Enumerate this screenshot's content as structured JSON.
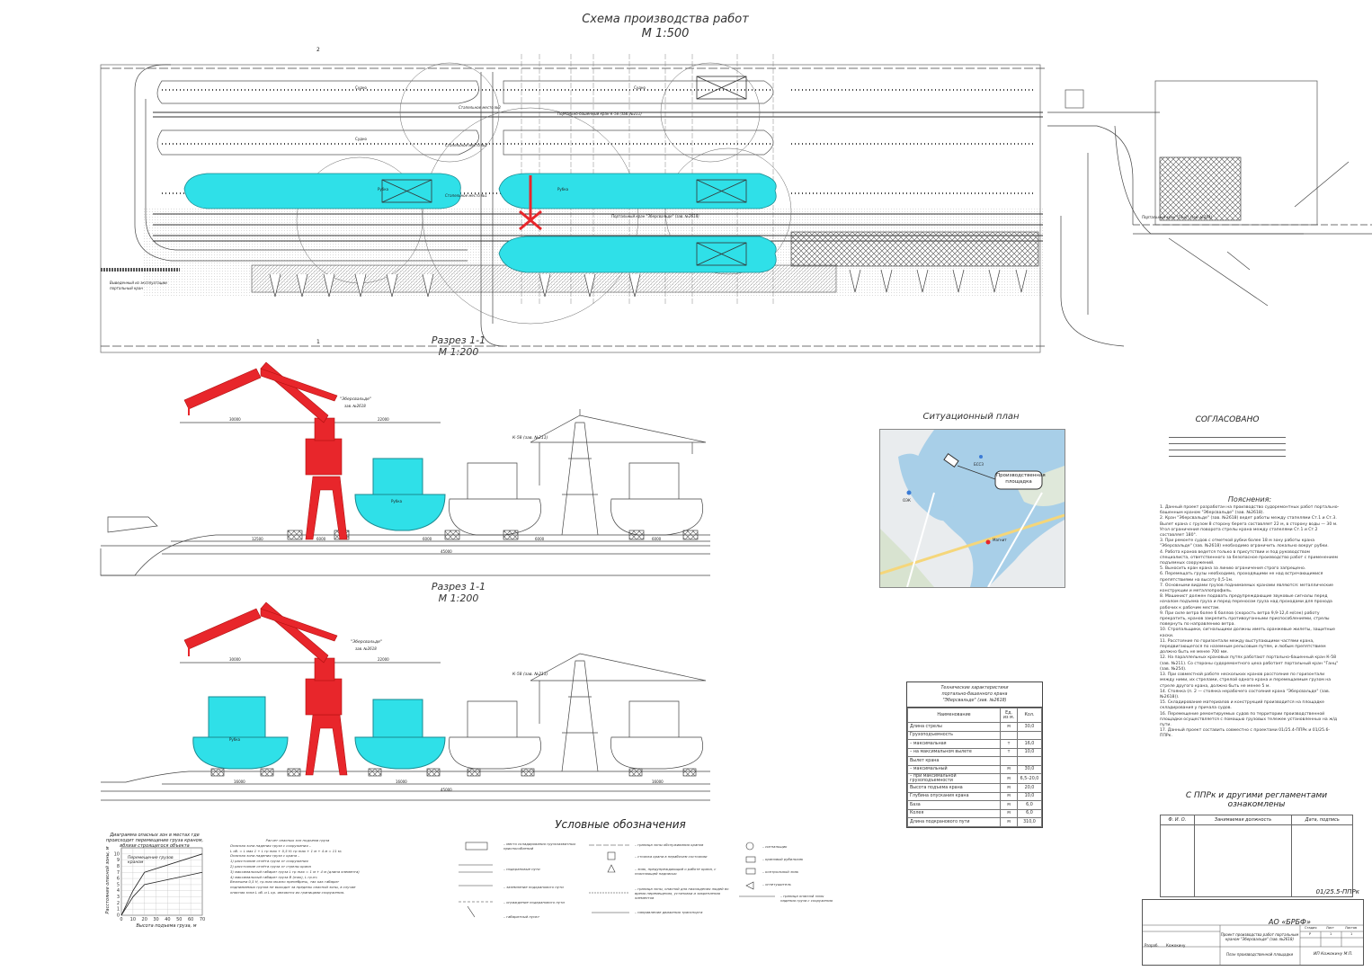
{
  "titles": {
    "main_title": "Схема производства работ",
    "main_scale": "М 1:500",
    "section1_title": "Разрез 1-1",
    "section1_scale": "М 1:200",
    "section2_title": "Разрез 1-1",
    "section2_scale": "М 1:200",
    "situation_title": "Ситуационный план"
  },
  "plan": {
    "berth_labels": [
      "Стапельное место №3",
      "Стапельное место №2",
      "Стапельное место №1"
    ],
    "hull_labels": [
      "Судно",
      "Судно",
      "Судно",
      "Рубка",
      "Рубка"
    ],
    "crane_rail_label_1": "Портально-башенный кран К-58 (зав. №211)",
    "crane_rail_label_2": "Портальный кран \"Зберсвальде\" (зав. №2618)",
    "crane_rail_label_3": "Портальный кран \"Ганц\" (зав. №254)",
    "out_of_service": "Выведенный из эксплуатации портальный кран",
    "marker_2": "2",
    "marker_1": "1"
  },
  "section1": {
    "crane_label": "\"Эберсвальде\"",
    "crane_label_2": "зав. №2618",
    "k58_label": "К-58 (зав. №211)",
    "hull_label": "Рубка",
    "dims": [
      "30000",
      "22000",
      "12500",
      "6000",
      "6000",
      "6000",
      "6000",
      "45000"
    ]
  },
  "section2": {
    "crane_label": "\"Эберсвальде\"",
    "crane_label_2": "зав. №2618",
    "k58_label": "К-58 (зав. №211)",
    "hull_label": "Рубка",
    "dims": [
      "30000",
      "22000",
      "16000",
      "16000",
      "16000",
      "45000"
    ]
  },
  "situation_map": {
    "callout": "Производственная площадка",
    "labels": [
      "БССЗ",
      "ОЭК",
      "Магнит"
    ]
  },
  "approved": {
    "title": "СОГЛАСОВАНО"
  },
  "notes": {
    "title": "Пояснения:",
    "items": [
      "1. Данный проект разработан на производство судоремонтных работ портально-башенным краном \"Эберсвальде\" (зав. №2618).",
      "2. Кран \"Эберсвальде\" (зав. №2618) ведет работы между стапелями Ст.1 и Ст.3. Вылет крана с грузом 8 сторону берега составляет 22 м, в сторону воды — 30 м. Угол ограничения поворота стрелы крана между стапелями Ст.1 и Ст.2 составляет 180°.",
      "3. При ремонте судов с отметкой рубки более 18 м зону работы крана \"Эберсвальде\" (зав. №2618) необходимо ограничить локально вокруг рубки.",
      "4. Работа кранов ведется только в присутствии и под руководством специалиста, ответственного за безопасное производство работ с применением подъемных сооружений.",
      "5. Выносить кран крана за линию ограничения строго запрещено.",
      "6. Перемещать грузы необходимо, проходящими не над встречающимися препятствиями на высоту 0,5-1м.",
      "7. Основными видами грузов поднимаемых кранами являются: металлические конструкции и металлопрофиль.",
      "8. Машинист должен подавать предупреждающие звуковые сигналы перед началом подъема груза и перед переносом груза над проходами для прохода рабочих к рабочим местам.",
      "9. При силе ветра более 6 баллов (скорость ветра 9,9-12,4 м/сек) работу прекратить, кранов закрепить противоугонными приспособлениями, стрелы повернуть по направлению ветра.",
      "10. Стропальщики, сигнальщики должны иметь оранжевые жилеты, защитные каски.",
      "11. Расстояние по горизонтали между выступающими частями крана, передвигающегося по наземным рельсовым путям, и любым препятствием должно быть не менее 700 мм.",
      "12. На параллельных крановых путях работают портально-башенный кран К-58 (зав. №211). Со стороны судоремонтного цеха работает портальный кран \"Ганц\" (зав. №254).",
      "13. При совместной работе нескольких кранов расстояние по горизонтали между ними, их стрелами, стрелой одного крана и перемещаемым грузом на стреле другого крана, должно быть не менее 5 м.",
      "14. Стоянка (п. 2 — стоянка нерабочего состояния крана \"Эберсвальде\" (зав. №2618)).",
      "15. Складирование материалов и конструкций производится на площадке складирования у причала судов.",
      "16. Перемещение ремонтируемых судов по территории производственной площадки осуществляется с помощью грузовых тележек установленных на ж/д пути.",
      "17. Данный проект составить совместно с проектами 01/25.4-ППРк и 01/25.6-ППРк."
    ]
  },
  "spec": {
    "title_line1": "Технические характеристики",
    "title_line2": "портально-башенного крана",
    "title_line3": "\"Эберсвальде\" (зав. №2618)",
    "col_name": "Наименование",
    "col_unit": "Ед. из м.",
    "col_val": "Кол.",
    "rows": [
      {
        "name": "Длина стрелы",
        "unit": "м",
        "val": "30,0"
      },
      {
        "name": "Грузоподъемность",
        "unit": "",
        "val": ""
      },
      {
        "name": "– максимальная",
        "unit": "т",
        "val": "16,0"
      },
      {
        "name": "– на максимальном вылете",
        "unit": "т",
        "val": "10,0"
      },
      {
        "name": "Вылет крана",
        "unit": "",
        "val": ""
      },
      {
        "name": "– максимальный",
        "unit": "м",
        "val": "30,0"
      },
      {
        "name": "– при максимальной грузоподъемности",
        "unit": "м",
        "val": "6,5–20,0"
      },
      {
        "name": "Высота подъема крана",
        "unit": "м",
        "val": "20,0"
      },
      {
        "name": "Глубина опускания крана",
        "unit": "м",
        "val": "10,0"
      },
      {
        "name": "База",
        "unit": "м",
        "val": "6,0"
      },
      {
        "name": "Колея",
        "unit": "м",
        "val": "6,0"
      },
      {
        "name": "Длина подкранового пути",
        "unit": "м",
        "val": "310,0"
      }
    ]
  },
  "familiarization": {
    "title": "С ППРк и другими регламентами ознакомлены",
    "cols": [
      "Ф. И. О.",
      "Занимаемая должность",
      "Дата, подпись"
    ]
  },
  "stamp": {
    "code": "01/25.5-ППРк",
    "org": "АО «БРБФ»",
    "project": "Проект производства работ портальным краном \"Эберсвальде\" (зав. №2618)",
    "sheet_title": "План производственной площадки",
    "firm": "ИП Кожокину М.П.",
    "developed": "Разраб.",
    "developer": "Кожокину",
    "stage": "Стадия",
    "sheet": "Лист",
    "sheets": "Листов",
    "stage_val": "Р",
    "sheet_val": "1",
    "sheets_val": "1"
  },
  "danger_chart": {
    "caption": "Диаграмма опасных зон в местах где происходит перемещение груза краном, вблизи строящегося объекта",
    "xlabel": "Высота подъема груза, м",
    "ylabel": "Расстояние опасной зоны, м",
    "legend": "Перемещение грузов краном",
    "x_ticks": [
      "0",
      "10",
      "20",
      "30",
      "40",
      "50",
      "60",
      "70"
    ],
    "y_ticks": [
      "0",
      "1",
      "2",
      "3",
      "4",
      "5",
      "6",
      "7",
      "8",
      "9",
      "10"
    ]
  },
  "chart_data": {
    "type": "line",
    "title": "Диаграмма опасных зон в местах где происходит перемещение груза краном, вблизи строящегося объекта",
    "xlabel": "Высота подъема груза, м",
    "ylabel": "Расстояние опасной зоны, м",
    "xlim": [
      0,
      70
    ],
    "ylim": [
      0,
      11
    ],
    "series": [
      {
        "name": "Перемещение грузов краном",
        "x": [
          0,
          10,
          20,
          70
        ],
        "y": [
          0,
          4,
          7,
          10
        ]
      },
      {
        "name": "",
        "x": [
          0,
          10,
          20,
          70
        ],
        "y": [
          0,
          3,
          5,
          7
        ]
      }
    ]
  },
  "calc": {
    "title": "Расчет опасных зон подъема груза",
    "lines": [
      "Опасная зона падения груза с сооружения –",
      "L об. = L мах 1 + L гр max + 0,5 Н; гр max + 1 м + 4 м = 11 м;",
      "Опасная зона падения груза с крана –",
      "1) расстояние отлёта груза от сооружения",
      "2) расстояние отлёта груза от стрелы крана",
      "3) максимальный габарит груза L гр max = 1 м + 4 м (длина элемента)",
      "4) максимальный габарит груза B (max), L гр.m;",
      "Величина 0,5 Н, гр.max можно пренебречь, так как габарит поднимаемых грузов не выходит за пределы опасной зоны, в случае опасная зона L об. и L кр. являются их границами сооружения."
    ]
  },
  "legend": {
    "title": "Условные обозначения",
    "items": [
      "– место складирования грузозахватных приспособлений",
      "– подкрановые пути",
      "– заземление подкранового пути",
      "– ограждение подкранового пути",
      "– контрольный знак",
      "– габаритный пункт",
      "– граница зоны обслуживания кранов",
      "– стоянка крана в нерабочем состоянии",
      "– знак, предупреждающий о работе крана, с поясняющей надписью",
      "– граница зоны, опасной для нахождения людей во время перемещения, установки и закрепления элементов",
      "– направление движения транспорта",
      "– сигнальщик",
      "– крановый рубильник",
      "– контрольный груз",
      "– огнетушитель",
      "– граница опасной зоны падения груза с сооружения"
    ]
  },
  "colors": {
    "crane": "#e8262b",
    "hull": "#2fe0e8",
    "line": "#333333"
  }
}
